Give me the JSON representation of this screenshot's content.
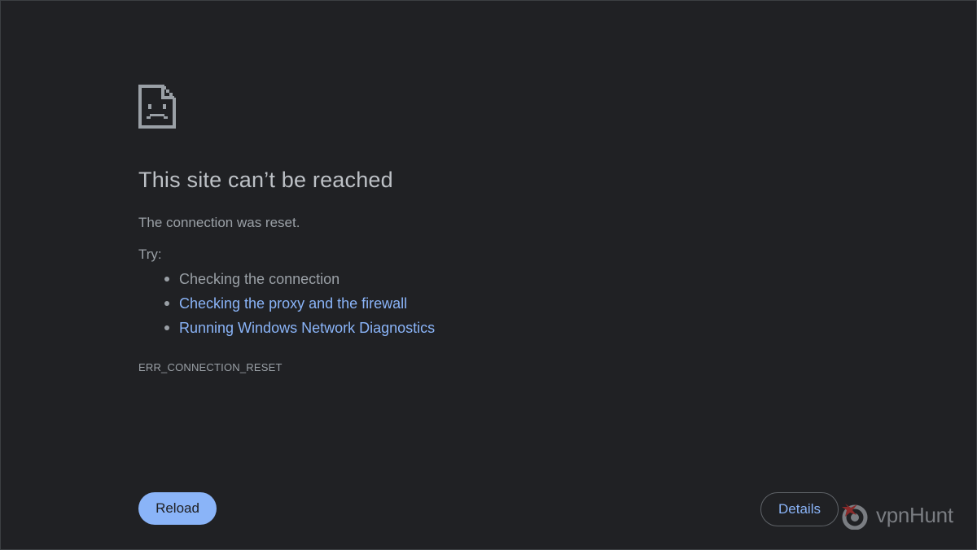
{
  "page": {
    "icon": "sad-document-icon",
    "title": "This site can’t be reached",
    "message": "The connection was reset.",
    "try_label": "Try:",
    "suggestions": [
      {
        "text": "Checking the connection",
        "is_link": false
      },
      {
        "text": "Checking the proxy and the firewall",
        "is_link": true
      },
      {
        "text": "Running Windows Network Diagnostics",
        "is_link": true
      }
    ],
    "error_code": "ERR_CONNECTION_RESET"
  },
  "buttons": {
    "reload_label": "Reload",
    "details_label": "Details"
  },
  "watermark": {
    "icon": "vpnhunt-logo-icon",
    "text": "vpnHunt"
  },
  "colors": {
    "background": "#202124",
    "link": "#8ab4f8",
    "text": "#9aa0a6",
    "title": "#bdc1c6"
  }
}
